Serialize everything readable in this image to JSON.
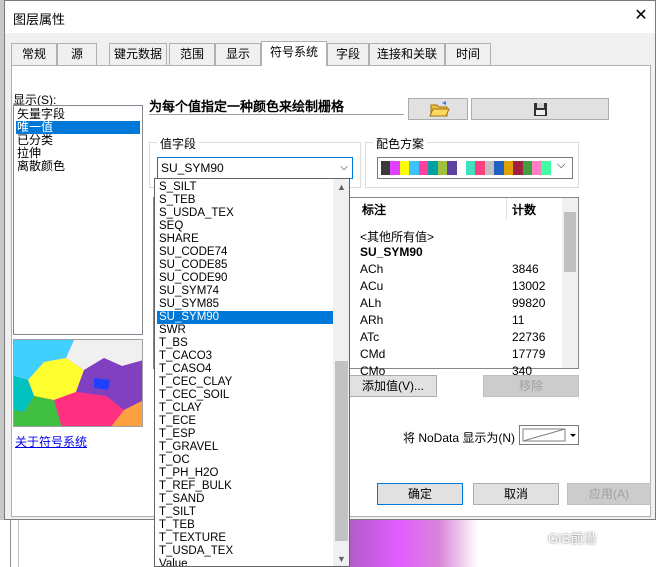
{
  "window": {
    "title": "图层属性",
    "close_glyph": "✕"
  },
  "tabs": [
    {
      "label": "常规",
      "active": false
    },
    {
      "label": "源",
      "active": false
    },
    {
      "label": "键元数据",
      "active": false
    },
    {
      "label": "范围",
      "active": false
    },
    {
      "label": "显示",
      "active": false
    },
    {
      "label": "符号系统",
      "active": true
    },
    {
      "label": "字段",
      "active": false
    },
    {
      "label": "连接和关联",
      "active": false
    },
    {
      "label": "时间",
      "active": false
    }
  ],
  "show": {
    "label": "显示(S):",
    "items": [
      "矢量字段",
      "唯一值",
      "已分类",
      "拉伸",
      "离散颜色"
    ],
    "selected_index": 1
  },
  "about_link": "关于符号系统",
  "heading": "为每个值指定一种颜色来绘制栅格",
  "value_field": {
    "label": "值字段",
    "value": "SU_SYM90",
    "options": [
      "S_SILT",
      "S_TEB",
      "S_USDA_TEX",
      "SEQ",
      "SHARE",
      "SU_CODE74",
      "SU_CODE85",
      "SU_CODE90",
      "SU_SYM74",
      "SU_SYM85",
      "SU_SYM90",
      "SWR",
      "T_BS",
      "T_CACO3",
      "T_CASO4",
      "T_CEC_CLAY",
      "T_CEC_SOIL",
      "T_CLAY",
      "T_ECE",
      "T_ESP",
      "T_GRAVEL",
      "T_OC",
      "T_PH_H2O",
      "T_REF_BULK",
      "T_SAND",
      "T_SILT",
      "T_TEB",
      "T_TEXTURE",
      "T_USDA_TEX",
      "Value"
    ],
    "selected_option": "SU_SYM90"
  },
  "color_scheme": {
    "label": "配色方案",
    "colors": [
      "#3a3a3a",
      "#e040ff",
      "#ffff00",
      "#40c0ff",
      "#ff40a0",
      "#00a0a0",
      "#a0c040",
      "#6040a0",
      "#ffffff",
      "#40e0c0",
      "#ff4080",
      "#c0c0c0",
      "#2060c0",
      "#e0a000",
      "#a02040",
      "#40a040",
      "#ff80c0",
      "#40ffa0"
    ]
  },
  "table": {
    "col_label": "标注",
    "col_count": "计数",
    "rows": [
      {
        "label": "<其他所有值>",
        "count": ""
      },
      {
        "label": "SU_SYM90",
        "count": "",
        "bold": true
      },
      {
        "label": "ACh",
        "count": "3846"
      },
      {
        "label": "ACu",
        "count": "13002"
      },
      {
        "label": "ALh",
        "count": "99820"
      },
      {
        "label": "ARh",
        "count": "11"
      },
      {
        "label": "ATc",
        "count": "22736"
      },
      {
        "label": "CMd",
        "count": "17779"
      },
      {
        "label": "CMo",
        "count": "340"
      }
    ]
  },
  "buttons": {
    "add_value": "添加值(V)...",
    "remove": "移除",
    "ok": "确定",
    "cancel": "取消",
    "apply": "应用(A)"
  },
  "nodata_label": "将 NoData 显示为(N)",
  "watermark": "GIS前沿"
}
